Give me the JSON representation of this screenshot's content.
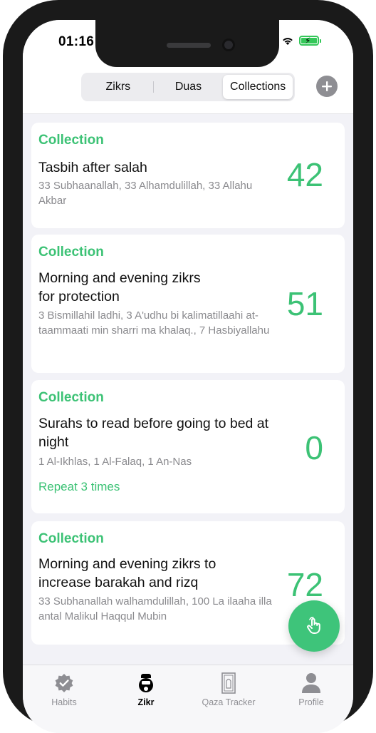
{
  "status_bar": {
    "time": "01:16"
  },
  "segments": {
    "items": [
      {
        "label": "Zikrs"
      },
      {
        "label": "Duas"
      },
      {
        "label": "Collections"
      }
    ],
    "active": "Collections"
  },
  "cards": [
    {
      "kind": "Collection",
      "title": "Tasbih after salah",
      "subtitle": "33 Subhaanallah, 33 Alhamdulillah, 33 Allahu Akbar",
      "count": "42"
    },
    {
      "kind": "Collection",
      "title": "Morning and evening zikrs for protection",
      "subtitle": "3 Bismillahil ladhi, 3 A'udhu bi kalimatillaahi at-taammaati min sharri ma khalaq., 7 Hasbiyallahu",
      "count": "51"
    },
    {
      "kind": "Collection",
      "title": "Surahs to read before going to bed at night",
      "subtitle": "1 Al-Ikhlas, 1 Al-Falaq, 1 An-Nas",
      "count": "0",
      "repeat": "Repeat 3 times"
    },
    {
      "kind": "Collection",
      "title": "Morning and evening zikrs to increase barakah and rizq",
      "subtitle": "33 Subhanallah walhamdulillah, 100 La ilaaha illa antal Malikul Haqqul Mubin",
      "count": "72"
    }
  ],
  "tabbar": {
    "items": [
      {
        "label": "Habits",
        "icon": "badge-check-icon"
      },
      {
        "label": "Zikr",
        "icon": "tasbih-counter-icon"
      },
      {
        "label": "Qaza Tracker",
        "icon": "prayer-rug-icon"
      },
      {
        "label": "Profile",
        "icon": "person-icon"
      }
    ],
    "active": "Zikr"
  },
  "colors": {
    "accent": "#3cc275",
    "fab": "#3ec47a",
    "battery": "#34c759"
  }
}
